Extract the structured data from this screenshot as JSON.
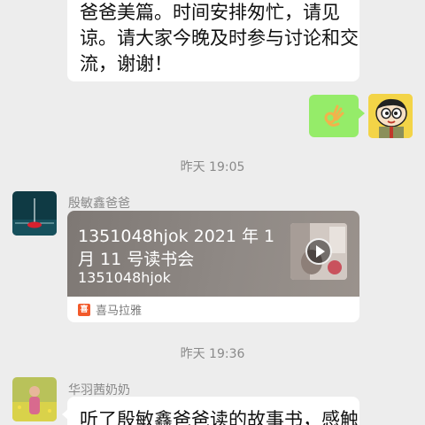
{
  "messages": {
    "first": {
      "lines": [
        "爸爸美篇。时间安排匆忙，请见",
        "谅。请大家今晚及时参与讨论和交",
        "流，谢谢！"
      ]
    },
    "sticker": {
      "icon": "ok-hand-icon"
    },
    "timestamp1": "昨天 19:05",
    "share": {
      "sender": "殷敏鑫爸爸",
      "title": "1351048hjok 2021 年 1 月 11 号读书会",
      "subtitle": "1351048hjok",
      "source": "喜马拉雅",
      "logo_text": "喜",
      "logo_icon": "ximalaya-logo-icon",
      "play_icon": "play-icon"
    },
    "timestamp2": "昨天 19:36",
    "last": {
      "sender": "华羽茜奶奶",
      "text": "听了殷敏鑫爸爸读的故事书，感触"
    }
  },
  "colors": {
    "chat_bg": "#ededed",
    "self_bubble": "#95ec69",
    "other_bubble": "#ffffff",
    "ximalaya": "#f25a2b"
  }
}
